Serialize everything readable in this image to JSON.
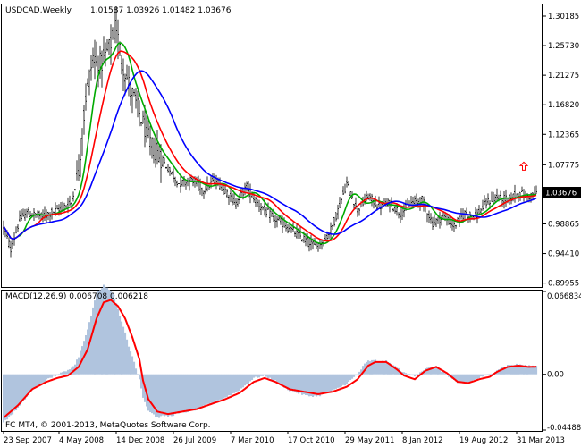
{
  "chart_data": [
    {
      "type": "line",
      "panel": "price",
      "title": "USDCAD,Weekly",
      "ohlc_text": "1.01587 1.03926 1.01482 1.03676",
      "current_price_label": "1.03676",
      "ylim": [
        0.895,
        1.318
      ],
      "y_ticks": [
        1.30185,
        1.2573,
        1.21275,
        1.1682,
        1.12365,
        1.07775,
        1.0332,
        0.98865,
        0.9441,
        0.89955
      ],
      "y_tick_labels": [
        "1.30185",
        "1.25730",
        "1.21275",
        "1.16820",
        "1.12365",
        "1.07775",
        "1.03320",
        "0.98865",
        "0.94410",
        "0.89955"
      ],
      "x_labels": [
        "23 Sep 2007",
        "4 May 2008",
        "14 Dec 2008",
        "26 Jul 2009",
        "7 Mar 2010",
        "17 Oct 2010",
        "29 May 2011",
        "8 Jan 2012",
        "19 Aug 2012",
        "31 Mar 2013"
      ],
      "x_label_positions": [
        0,
        31,
        63,
        95,
        127,
        159,
        191,
        223,
        255,
        287
      ],
      "bar_count": 299,
      "price_anchors": [
        [
          0,
          0.985
        ],
        [
          4,
          0.95
        ],
        [
          9,
          0.995
        ],
        [
          13,
          1.005
        ],
        [
          22,
          1.0
        ],
        [
          30,
          1.01
        ],
        [
          38,
          1.02
        ],
        [
          42,
          1.07
        ],
        [
          46,
          1.18
        ],
        [
          50,
          1.24
        ],
        [
          55,
          1.23
        ],
        [
          60,
          1.26
        ],
        [
          63,
          1.285
        ],
        [
          66,
          1.235
        ],
        [
          70,
          1.2
        ],
        [
          76,
          1.155
        ],
        [
          82,
          1.11
        ],
        [
          90,
          1.08
        ],
        [
          98,
          1.05
        ],
        [
          106,
          1.055
        ],
        [
          112,
          1.04
        ],
        [
          118,
          1.055
        ],
        [
          124,
          1.04
        ],
        [
          130,
          1.02
        ],
        [
          136,
          1.045
        ],
        [
          142,
          1.02
        ],
        [
          150,
          1.0
        ],
        [
          158,
          0.985
        ],
        [
          166,
          0.97
        ],
        [
          174,
          0.955
        ],
        [
          180,
          0.965
        ],
        [
          184,
          0.985
        ],
        [
          192,
          1.05
        ],
        [
          198,
          1.01
        ],
        [
          204,
          1.03
        ],
        [
          210,
          1.015
        ],
        [
          216,
          1.02
        ],
        [
          222,
          1.005
        ],
        [
          228,
          1.02
        ],
        [
          234,
          1.025
        ],
        [
          240,
          0.99
        ],
        [
          246,
          1.0
        ],
        [
          252,
          0.985
        ],
        [
          258,
          1.005
        ],
        [
          264,
          1.0
        ],
        [
          270,
          1.02
        ],
        [
          276,
          1.03
        ],
        [
          282,
          1.025
        ],
        [
          288,
          1.035
        ],
        [
          294,
          1.03
        ],
        [
          298,
          1.0368
        ]
      ],
      "moving_averages": [
        {
          "color": "#00aa00",
          "period": 4
        },
        {
          "color": "#ff0000",
          "period": 8
        },
        {
          "color": "#0000ff",
          "period": 16
        }
      ],
      "colors": {
        "bars": "#000000",
        "arrow": "#ff0000",
        "label_bg": "#000000",
        "label_text": "#ffffff"
      }
    },
    {
      "type": "area",
      "panel": "macd",
      "title": "MACD(12,26,9) 0.006708 0.006218",
      "ylim": [
        -0.044883,
        0.066834
      ],
      "y_ticks": [
        0.066834,
        0.0,
        -0.044883
      ],
      "y_tick_labels": [
        "0.066834",
        "0.00",
        "-0.044883"
      ],
      "signal_anchors": [
        [
          0,
          -0.035
        ],
        [
          8,
          -0.025
        ],
        [
          16,
          -0.012
        ],
        [
          24,
          -0.006
        ],
        [
          30,
          -0.003
        ],
        [
          36,
          -0.001
        ],
        [
          42,
          0.006
        ],
        [
          47,
          0.02
        ],
        [
          52,
          0.045
        ],
        [
          56,
          0.058
        ],
        [
          60,
          0.06
        ],
        [
          64,
          0.055
        ],
        [
          68,
          0.045
        ],
        [
          72,
          0.03
        ],
        [
          76,
          0.012
        ],
        [
          78,
          -0.005
        ],
        [
          81,
          -0.02
        ],
        [
          86,
          -0.03
        ],
        [
          92,
          -0.032
        ],
        [
          100,
          -0.03
        ],
        [
          108,
          -0.028
        ],
        [
          116,
          -0.024
        ],
        [
          124,
          -0.02
        ],
        [
          132,
          -0.015
        ],
        [
          140,
          -0.006
        ],
        [
          146,
          -0.003
        ],
        [
          152,
          -0.006
        ],
        [
          160,
          -0.012
        ],
        [
          168,
          -0.014
        ],
        [
          176,
          -0.016
        ],
        [
          184,
          -0.014
        ],
        [
          192,
          -0.01
        ],
        [
          198,
          -0.004
        ],
        [
          204,
          0.007
        ],
        [
          208,
          0.01
        ],
        [
          214,
          0.01
        ],
        [
          220,
          0.004
        ],
        [
          224,
          -0.001
        ],
        [
          230,
          -0.004
        ],
        [
          236,
          0.003
        ],
        [
          242,
          0.006
        ],
        [
          248,
          0.001
        ],
        [
          254,
          -0.006
        ],
        [
          260,
          -0.007
        ],
        [
          266,
          -0.004
        ],
        [
          272,
          -0.002
        ],
        [
          276,
          0.002
        ],
        [
          282,
          0.006
        ],
        [
          288,
          0.007
        ],
        [
          294,
          0.006
        ],
        [
          298,
          0.0062
        ]
      ],
      "hist_offset": [
        [
          0,
          -0.004
        ],
        [
          40,
          0.005
        ],
        [
          46,
          0.015
        ],
        [
          52,
          0.02
        ],
        [
          56,
          0.014
        ],
        [
          62,
          0.004
        ],
        [
          66,
          -0.008
        ],
        [
          70,
          -0.015
        ],
        [
          76,
          -0.016
        ],
        [
          82,
          -0.008
        ],
        [
          90,
          -0.002
        ],
        [
          110,
          0.0
        ],
        [
          140,
          0.003
        ],
        [
          170,
          -0.003
        ],
        [
          190,
          0.002
        ],
        [
          202,
          0.005
        ],
        [
          210,
          0.0
        ],
        [
          230,
          0.003
        ],
        [
          250,
          -0.002
        ],
        [
          270,
          0.002
        ],
        [
          298,
          0.0005
        ]
      ],
      "colors": {
        "histogram": "#b0c4de",
        "signal": "#ff0000"
      }
    }
  ],
  "footer": {
    "copyright": "FC MT4, © 2001-2013, MetaQuotes Software Corp."
  }
}
